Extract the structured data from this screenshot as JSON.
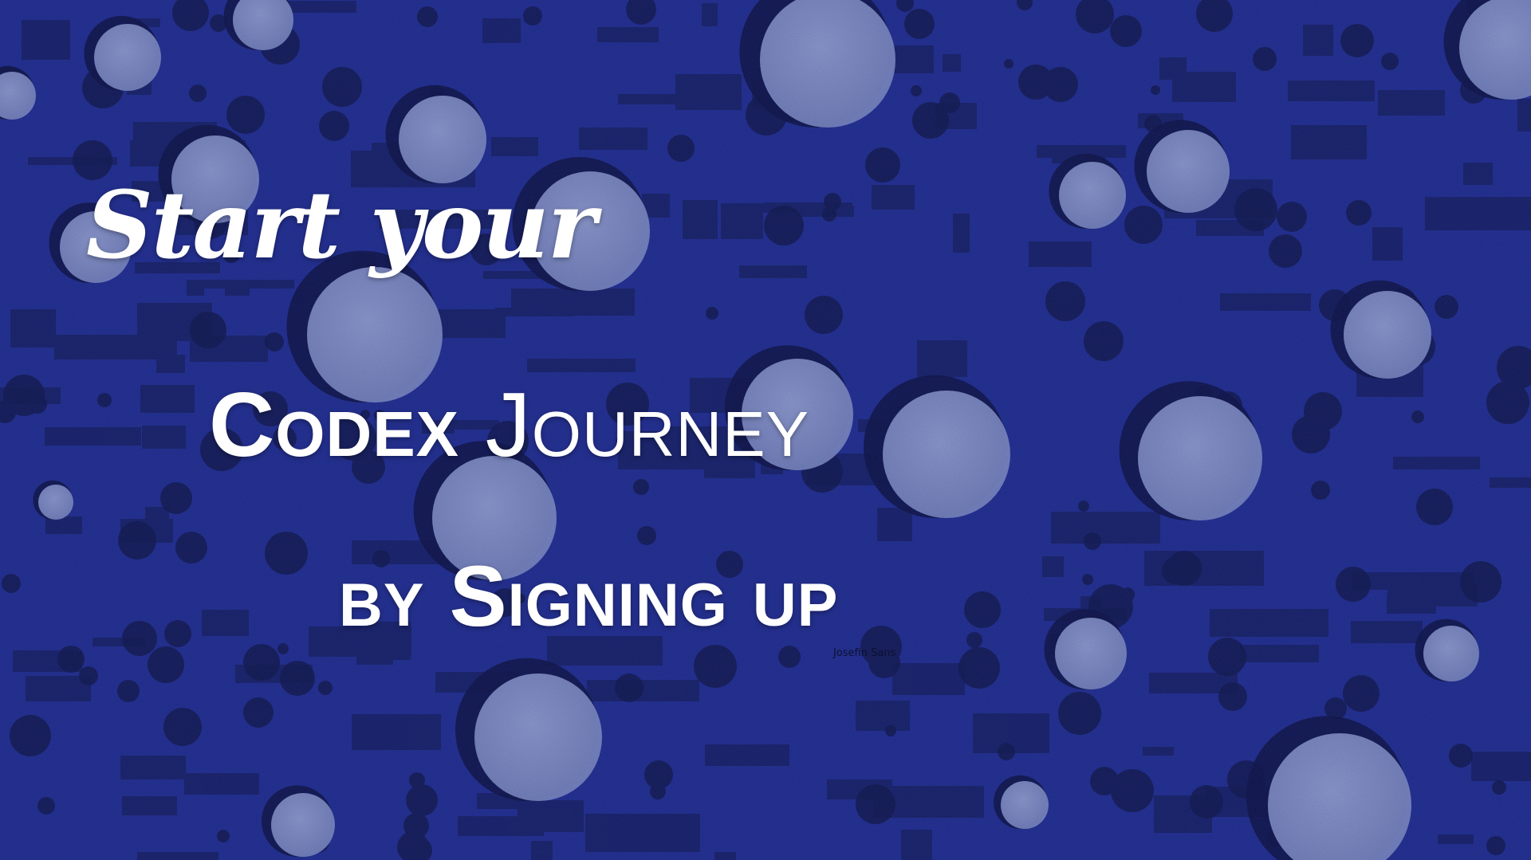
{
  "headline": {
    "line1": "Start your",
    "line2_word1": "Codex",
    "line2_word2": "Journey",
    "line3": "by Signing up"
  },
  "caption": "Josefin Sans",
  "colors": {
    "background": "#1e2a8a",
    "background_dark": "#131a55",
    "circle_light": "#8f9ccc",
    "text": "#ffffff",
    "caption_text": "#0b1030"
  }
}
